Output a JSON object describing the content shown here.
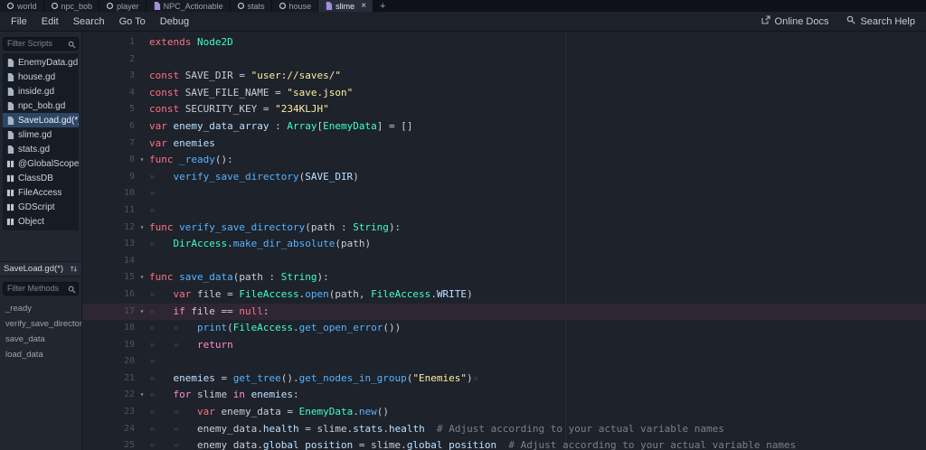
{
  "colors": {
    "keyword": "#ff7085",
    "control_flow": "#ff8ccc",
    "type": "#42ffc2",
    "function_call": "#57b3ff",
    "string": "#ffeda1",
    "text": "#cdced3",
    "member": "#bce0ff",
    "comment": "#79818f",
    "tab_marker": "#3d4552",
    "selection": "#2d4666",
    "current_line": "#2e2733",
    "line_number": "#4a5463"
  },
  "scene_tabs": [
    {
      "label": "world",
      "icon": "node"
    },
    {
      "label": "npc_bob",
      "icon": "node"
    },
    {
      "label": "player",
      "icon": "node"
    },
    {
      "label": "NPC_Actionable",
      "icon": "script"
    },
    {
      "label": "stats",
      "icon": "node"
    },
    {
      "label": "house",
      "icon": "node"
    },
    {
      "label": "slime",
      "icon": "script",
      "active": true,
      "closable": true
    }
  ],
  "tabs_add_label": "+",
  "menu": {
    "items": [
      "File",
      "Edit",
      "Search",
      "Go To",
      "Debug"
    ],
    "online_docs": "Online Docs",
    "search_help": "Search Help"
  },
  "scripts_panel": {
    "filter_scripts_placeholder": "Filter Scripts",
    "scripts": [
      {
        "label": "EnemyData.gd",
        "icon": "script"
      },
      {
        "label": "house.gd",
        "icon": "script"
      },
      {
        "label": "inside.gd",
        "icon": "script"
      },
      {
        "label": "npc_bob.gd",
        "icon": "script"
      },
      {
        "label": "SaveLoad.gd(*)",
        "icon": "script",
        "selected": true
      },
      {
        "label": "slime.gd",
        "icon": "script"
      },
      {
        "label": "stats.gd",
        "icon": "script"
      },
      {
        "label": "@GlobalScope",
        "icon": "class"
      },
      {
        "label": "ClassDB",
        "icon": "class"
      },
      {
        "label": "FileAccess",
        "icon": "class"
      },
      {
        "label": "GDScript",
        "icon": "class"
      },
      {
        "label": "Object",
        "icon": "class"
      }
    ],
    "current_script_label": "SaveLoad.gd(*)",
    "filter_methods_placeholder": "Filter Methods",
    "methods": [
      "_ready",
      "verify_save_directory",
      "save_data",
      "load_data"
    ]
  },
  "editor": {
    "lines": [
      {
        "n": 1,
        "tokens": [
          [
            "kw",
            "extends"
          ],
          [
            "pl",
            " "
          ],
          [
            "ty",
            "Node2D"
          ]
        ]
      },
      {
        "n": 2,
        "tokens": []
      },
      {
        "n": 3,
        "tokens": [
          [
            "kw",
            "const"
          ],
          [
            "pl",
            " SAVE_DIR = "
          ],
          [
            "st",
            "\"user://saves/\""
          ]
        ]
      },
      {
        "n": 4,
        "tokens": [
          [
            "kw",
            "const"
          ],
          [
            "pl",
            " SAVE_FILE_NAME = "
          ],
          [
            "st",
            "\"save.json\""
          ]
        ]
      },
      {
        "n": 5,
        "tokens": [
          [
            "kw",
            "const"
          ],
          [
            "pl",
            " SECURITY_KEY = "
          ],
          [
            "st",
            "\"234KLJH\""
          ]
        ]
      },
      {
        "n": 6,
        "tokens": [
          [
            "kw",
            "var"
          ],
          [
            "pl",
            " "
          ],
          [
            "mb",
            "enemy_data_array"
          ],
          [
            "pl",
            " : "
          ],
          [
            "ty",
            "Array"
          ],
          [
            "pl",
            "["
          ],
          [
            "ty",
            "EnemyData"
          ],
          [
            "pl",
            "] = []"
          ]
        ]
      },
      {
        "n": 7,
        "tokens": [
          [
            "kw",
            "var"
          ],
          [
            "pl",
            " "
          ],
          [
            "mb",
            "enemies"
          ]
        ]
      },
      {
        "n": 8,
        "fold": true,
        "tokens": [
          [
            "kw",
            "func"
          ],
          [
            "pl",
            " "
          ],
          [
            "fn",
            "_ready"
          ],
          [
            "pl",
            "():"
          ]
        ]
      },
      {
        "n": 9,
        "tokens": [
          [
            "tb",
            "»   "
          ],
          [
            "fn",
            "verify_save_directory"
          ],
          [
            "pl",
            "("
          ],
          [
            "mb",
            "SAVE_DIR"
          ],
          [
            "pl",
            ")"
          ]
        ]
      },
      {
        "n": 10,
        "tokens": [
          [
            "tb",
            "»   "
          ]
        ]
      },
      {
        "n": 11,
        "tokens": [
          [
            "tb",
            "»   "
          ]
        ]
      },
      {
        "n": 12,
        "fold": true,
        "tokens": [
          [
            "kw",
            "func"
          ],
          [
            "pl",
            " "
          ],
          [
            "fn",
            "verify_save_directory"
          ],
          [
            "pl",
            "(path : "
          ],
          [
            "ty",
            "String"
          ],
          [
            "pl",
            "):"
          ]
        ]
      },
      {
        "n": 13,
        "tokens": [
          [
            "tb",
            "»   "
          ],
          [
            "ty",
            "DirAccess"
          ],
          [
            "pl",
            "."
          ],
          [
            "fn",
            "make_dir_absolute"
          ],
          [
            "pl",
            "(path)"
          ]
        ]
      },
      {
        "n": 14,
        "tokens": []
      },
      {
        "n": 15,
        "fold": true,
        "tokens": [
          [
            "kw",
            "func"
          ],
          [
            "pl",
            " "
          ],
          [
            "fn",
            "save_data"
          ],
          [
            "pl",
            "(path : "
          ],
          [
            "ty",
            "String"
          ],
          [
            "pl",
            "):"
          ]
        ]
      },
      {
        "n": 16,
        "tokens": [
          [
            "tb",
            "»   "
          ],
          [
            "kw",
            "var"
          ],
          [
            "pl",
            " file = "
          ],
          [
            "ty",
            "FileAccess"
          ],
          [
            "pl",
            "."
          ],
          [
            "fn",
            "open"
          ],
          [
            "pl",
            "(path, "
          ],
          [
            "ty",
            "FileAccess"
          ],
          [
            "pl",
            "."
          ],
          [
            "mb",
            "WRITE"
          ],
          [
            "pl",
            ")"
          ]
        ]
      },
      {
        "n": 17,
        "fold": true,
        "hl": true,
        "tokens": [
          [
            "tb",
            "»   "
          ],
          [
            "cf",
            "if"
          ],
          [
            "pl",
            " file == "
          ],
          [
            "kw",
            "null"
          ],
          [
            "pl",
            ":"
          ]
        ]
      },
      {
        "n": 18,
        "tokens": [
          [
            "tb",
            "»   "
          ],
          [
            "tb",
            "»   "
          ],
          [
            "fn",
            "print"
          ],
          [
            "pl",
            "("
          ],
          [
            "ty",
            "FileAccess"
          ],
          [
            "pl",
            "."
          ],
          [
            "fn",
            "get_open_error"
          ],
          [
            "pl",
            "())"
          ]
        ]
      },
      {
        "n": 19,
        "tokens": [
          [
            "tb",
            "»   "
          ],
          [
            "tb",
            "»   "
          ],
          [
            "cf",
            "return"
          ]
        ]
      },
      {
        "n": 20,
        "tokens": [
          [
            "tb",
            "»   "
          ]
        ]
      },
      {
        "n": 21,
        "tokens": [
          [
            "tb",
            "»   "
          ],
          [
            "mb",
            "enemies"
          ],
          [
            "pl",
            " = "
          ],
          [
            "fn",
            "get_tree"
          ],
          [
            "pl",
            "()."
          ],
          [
            "fn",
            "get_nodes_in_group"
          ],
          [
            "pl",
            "("
          ],
          [
            "st",
            "\"Enemies\""
          ],
          [
            "pl",
            ")"
          ],
          [
            "tb",
            "»"
          ]
        ]
      },
      {
        "n": 22,
        "fold": true,
        "tokens": [
          [
            "tb",
            "»   "
          ],
          [
            "cf",
            "for"
          ],
          [
            "pl",
            " slime "
          ],
          [
            "cf",
            "in"
          ],
          [
            "pl",
            " "
          ],
          [
            "mb",
            "enemies"
          ],
          [
            "pl",
            ":"
          ]
        ]
      },
      {
        "n": 23,
        "tokens": [
          [
            "tb",
            "»   "
          ],
          [
            "tb",
            "»   "
          ],
          [
            "kw",
            "var"
          ],
          [
            "pl",
            " enemy_data = "
          ],
          [
            "ty",
            "EnemyData"
          ],
          [
            "pl",
            "."
          ],
          [
            "fn",
            "new"
          ],
          [
            "pl",
            "()"
          ]
        ]
      },
      {
        "n": 24,
        "tokens": [
          [
            "tb",
            "»   "
          ],
          [
            "tb",
            "»   "
          ],
          [
            "pl",
            "enemy_data."
          ],
          [
            "mb",
            "health"
          ],
          [
            "pl",
            " = slime."
          ],
          [
            "mb",
            "stats"
          ],
          [
            "pl",
            "."
          ],
          [
            "mb",
            "health"
          ],
          [
            "cm",
            "  # Adjust according to your actual variable names"
          ]
        ]
      },
      {
        "n": 25,
        "tokens": [
          [
            "tb",
            "»   "
          ],
          [
            "tb",
            "»   "
          ],
          [
            "pl",
            "enemy_data."
          ],
          [
            "mb",
            "global_position"
          ],
          [
            "pl",
            " = slime."
          ],
          [
            "mb",
            "global_position"
          ],
          [
            "cm",
            "  # Adjust according to your actual variable names"
          ]
        ]
      }
    ]
  }
}
